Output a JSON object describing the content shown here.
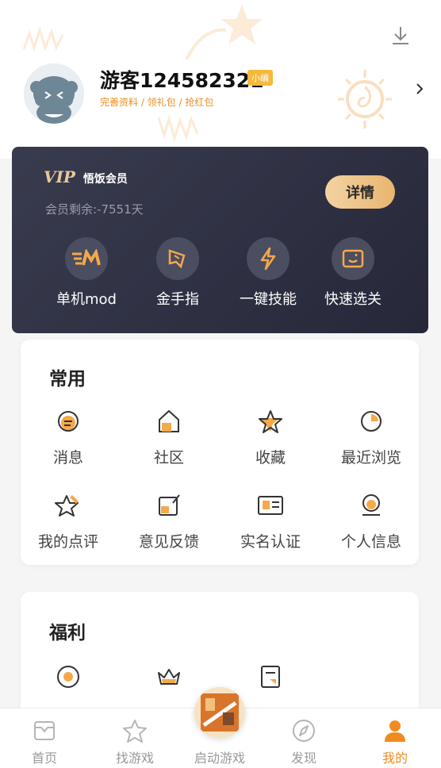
{
  "profile": {
    "username": "游客124582321",
    "tag": "小编",
    "links": "完善资料 / 领礼包 / 抢红包"
  },
  "vip": {
    "title": "悟饭会员",
    "logo_text": "VIP",
    "remaining": "会员剩余:-7551天",
    "detail_label": "详情",
    "features": [
      {
        "label": "单机mod",
        "icon": "mod-icon"
      },
      {
        "label": "金手指",
        "icon": "golden-finger-icon"
      },
      {
        "label": "一键技能",
        "icon": "lightning-icon"
      },
      {
        "label": "快速选关",
        "icon": "level-select-icon"
      }
    ]
  },
  "common": {
    "title": "常用",
    "items": [
      {
        "label": "消息",
        "icon": "message-icon"
      },
      {
        "label": "社区",
        "icon": "community-icon"
      },
      {
        "label": "收藏",
        "icon": "favorite-icon"
      },
      {
        "label": "最近浏览",
        "icon": "recent-icon"
      },
      {
        "label": "我的点评",
        "icon": "review-icon"
      },
      {
        "label": "意见反馈",
        "icon": "feedback-icon"
      },
      {
        "label": "实名认证",
        "icon": "id-card-icon"
      },
      {
        "label": "个人信息",
        "icon": "profile-icon"
      }
    ]
  },
  "welfare": {
    "title": "福利",
    "items": [
      {
        "label": "",
        "icon": "record-icon"
      },
      {
        "label": "",
        "icon": "crown-icon"
      },
      {
        "label": "",
        "icon": "gift-icon"
      }
    ]
  },
  "nav": {
    "items": [
      {
        "label": "首页",
        "icon": "home-icon"
      },
      {
        "label": "找游戏",
        "icon": "star-icon"
      },
      {
        "label": "启动游戏",
        "icon": "launch-game-icon"
      },
      {
        "label": "发现",
        "icon": "compass-icon"
      },
      {
        "label": "我的",
        "icon": "user-icon"
      }
    ],
    "active": "我的"
  },
  "colors": {
    "accent": "#f08c1f",
    "vip_bg": "#2c2e40",
    "vip_gold": "#e8b56f"
  }
}
